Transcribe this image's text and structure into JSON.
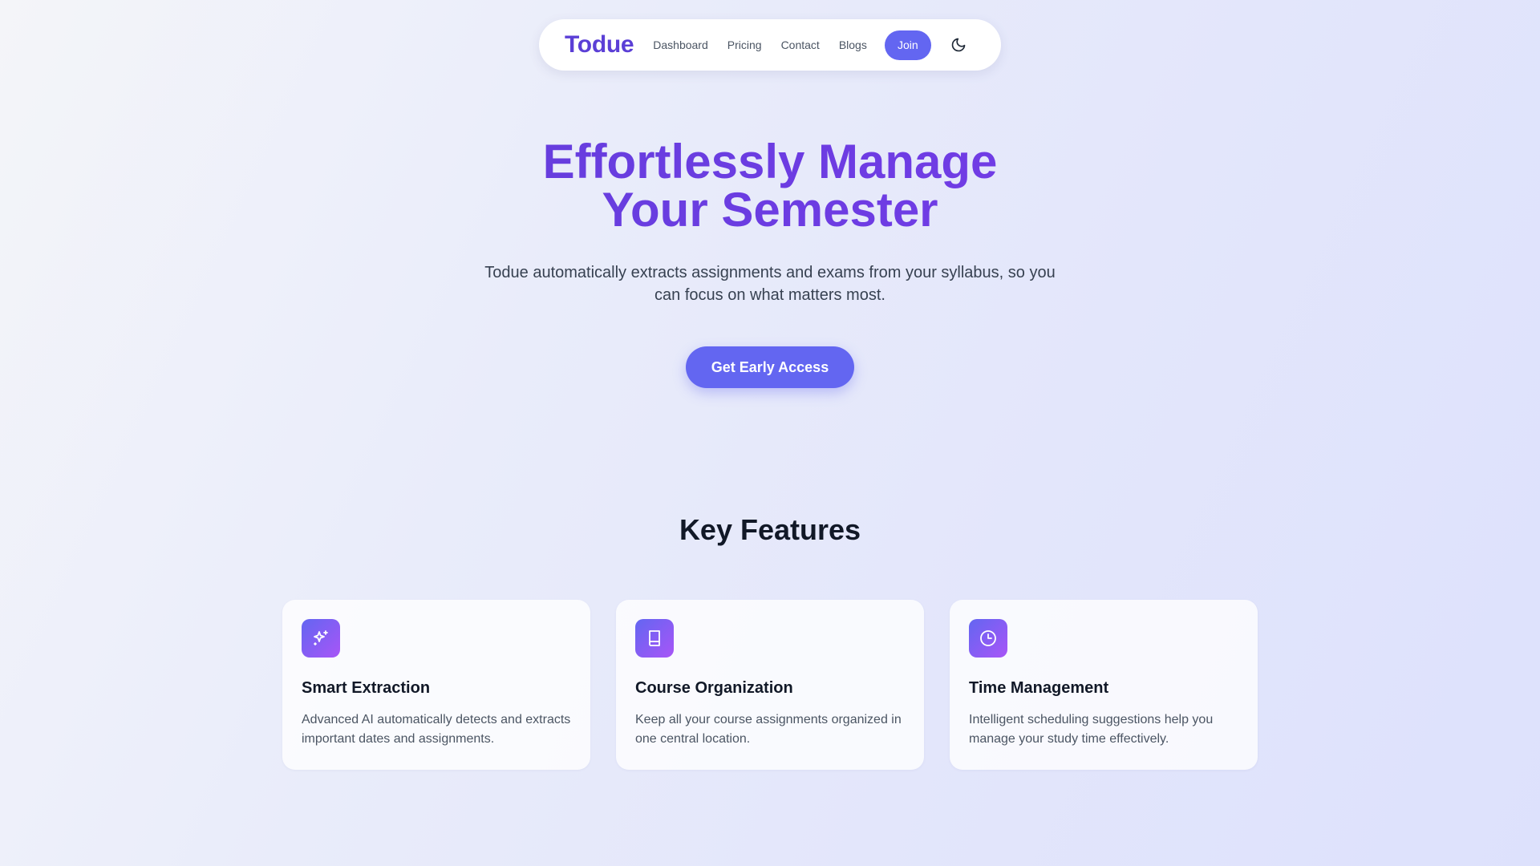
{
  "nav": {
    "brand": "Todue",
    "links": [
      {
        "label": "Dashboard"
      },
      {
        "label": "Pricing"
      },
      {
        "label": "Contact"
      },
      {
        "label": "Blogs"
      }
    ],
    "join_label": "Join",
    "theme_icon": "moon-icon"
  },
  "hero": {
    "title_line1": "Effortlessly Manage",
    "title_line2": "Your Semester",
    "subtitle": "Todue automatically extracts assignments and exams from your syllabus, so you can focus on what matters most.",
    "cta_label": "Get Early Access"
  },
  "features": {
    "heading": "Key Features",
    "items": [
      {
        "icon": "sparkles-icon",
        "title": "Smart Extraction",
        "description": "Advanced AI automatically detects and extracts important dates and assignments."
      },
      {
        "icon": "book-icon",
        "title": "Course Organization",
        "description": "Keep all your course assignments organized in one central location."
      },
      {
        "icon": "clock-icon",
        "title": "Time Management",
        "description": "Intelligent scheduling suggestions help you manage your study time effectively."
      }
    ]
  },
  "colors": {
    "brand": "#5b3fd6",
    "accent": "#6366f1",
    "gradient_end": "#a855f7",
    "text_dark": "#111827",
    "text_muted": "#4b5563"
  }
}
